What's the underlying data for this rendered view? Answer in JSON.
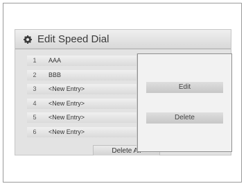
{
  "header": {
    "title": "Edit Speed Dial",
    "icon": "gear-icon"
  },
  "entries": [
    {
      "number": "1",
      "label": "AAA"
    },
    {
      "number": "2",
      "label": "BBB"
    },
    {
      "number": "3",
      "label": "<New Entry>"
    },
    {
      "number": "4",
      "label": "<New Entry>"
    },
    {
      "number": "5",
      "label": "<New Entry>"
    },
    {
      "number": "6",
      "label": "<New Entry>"
    }
  ],
  "popup": {
    "edit_label": "Edit",
    "delete_label": "Delete"
  },
  "footer": {
    "delete_all_label": "Delete All"
  }
}
